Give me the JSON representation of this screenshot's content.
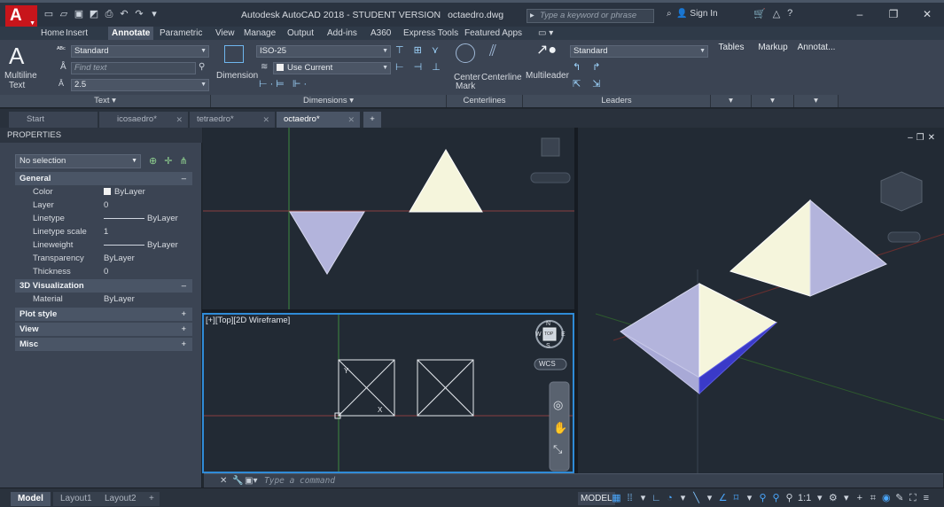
{
  "window": {
    "app_title": "Autodesk AutoCAD 2018 - STUDENT VERSION",
    "file_name": "octaedro.dwg",
    "search_placeholder": "Type a keyword or phrase",
    "signin_label": "Sign In"
  },
  "ribbon_tabs": [
    "Home",
    "Insert",
    "Annotate",
    "Parametric",
    "View",
    "Manage",
    "Output",
    "Add-ins",
    "A360",
    "Express Tools",
    "Featured Apps"
  ],
  "active_ribbon_tab": "Annotate",
  "ribbon": {
    "text_panel": {
      "multiline_text_label": "Multiline",
      "multiline_text_label2": "Text",
      "text_style": "Standard",
      "find_text_placeholder": "Find text",
      "text_height": "2.5",
      "panel_label": "Text"
    },
    "dimensions_panel": {
      "dimension_label": "Dimension",
      "dim_style": "ISO-25",
      "layer_value": "Use Current",
      "panel_label": "Dimensions"
    },
    "centerlines_panel": {
      "center_mark_label": "Center",
      "center_mark_label2": "Mark",
      "centerline_label": "Centerline",
      "panel_label": "Centerlines"
    },
    "leaders_panel": {
      "multileader_label": "Multileader",
      "leader_style": "Standard",
      "panel_label": "Leaders"
    },
    "extra_panels": [
      "Tables",
      "Markup",
      "Annotat..."
    ]
  },
  "file_tabs": [
    {
      "label": "Start",
      "active": false,
      "closable": false
    },
    {
      "label": "icosaedro*",
      "active": false,
      "closable": true
    },
    {
      "label": "tetraedro*",
      "active": false,
      "closable": true
    },
    {
      "label": "octaedro*",
      "active": true,
      "closable": true
    }
  ],
  "properties": {
    "title": "PROPERTIES",
    "selection": "No selection",
    "general": {
      "header": "General",
      "rows": [
        {
          "key": "Color",
          "value": "ByLayer"
        },
        {
          "key": "Layer",
          "value": "0"
        },
        {
          "key": "Linetype",
          "value": "ByLayer"
        },
        {
          "key": "Linetype scale",
          "value": "1"
        },
        {
          "key": "Lineweight",
          "value": "ByLayer"
        },
        {
          "key": "Transparency",
          "value": "ByLayer"
        },
        {
          "key": "Thickness",
          "value": "0"
        }
      ]
    },
    "visualization": {
      "header": "3D Visualization",
      "rows": [
        {
          "key": "Material",
          "value": "ByLayer"
        }
      ]
    },
    "collapsed": [
      "Plot style",
      "View",
      "Misc"
    ]
  },
  "viewports": {
    "bottom_left_label": "[+][Top][2D Wireframe]",
    "wcs_label": "WCS",
    "compass": {
      "n": "N",
      "s": "S",
      "w": "W",
      "e": "E",
      "top": "TOP"
    }
  },
  "command_line": {
    "placeholder": "Type a command"
  },
  "status_bar": {
    "layout_tabs": [
      "Model",
      "Layout1",
      "Layout2"
    ],
    "active_layout": "Model",
    "model_label": "MODEL",
    "scale": "1:1"
  },
  "colors": {
    "face_light": "#f5f5dc",
    "face_lilac": "#b3b4dc",
    "face_blue": "#3a3ac8",
    "accent": "#2f8bd7"
  }
}
